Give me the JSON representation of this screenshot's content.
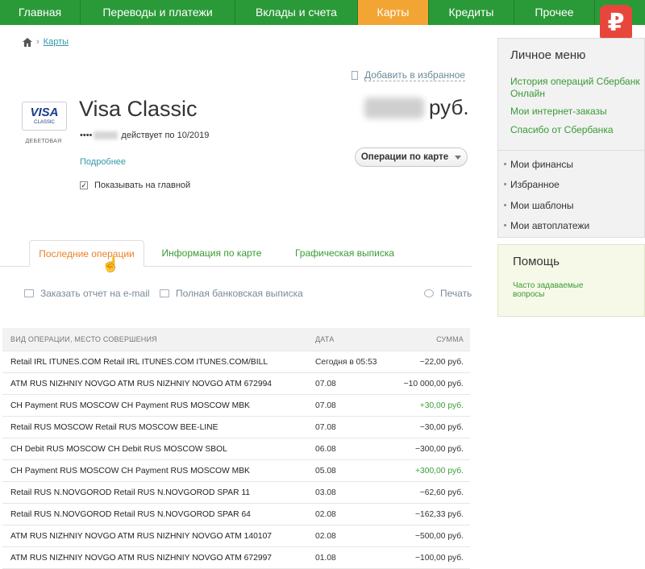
{
  "nav": [
    "Главная",
    "Переводы и платежи",
    "Вклады и счета",
    "Карты",
    "Кредиты",
    "Прочее"
  ],
  "nav_active": "Карты",
  "logo": "₽",
  "breadcrumb": {
    "current": "Карты"
  },
  "favorite": "Добавить в избранное",
  "card": {
    "brand": "VISA",
    "brand_sub": "CLASSIC",
    "type": "ДЕБЕТОВАЯ",
    "title": "Visa Classic",
    "number_prefix": "••••",
    "valid": "действует по 10/2019",
    "details": "Подробнее",
    "show_on_main": "Показывать на главной",
    "currency": "руб."
  },
  "ops_button": "Операции по карте",
  "tabs": [
    "Последние операции",
    "Информация по карте",
    "Графическая выписка"
  ],
  "actions": [
    "Заказать отчет на e-mail",
    "Полная банковская выписка",
    "Печать"
  ],
  "table": {
    "headers": [
      "ВИД ОПЕРАЦИИ, МЕСТО СОВЕРШЕНИЯ",
      "ДАТА",
      "СУММА"
    ],
    "rows": [
      {
        "desc": "Retail IRL ITUNES.COM Retail IRL ITUNES.COM ITUNES.COM/BILL",
        "date": "Сегодня в 05:53",
        "sum": "−22,00 руб.",
        "pos": false
      },
      {
        "desc": "ATM RUS NIZHNIY NOVGO ATM RUS NIZHNIY NOVGO ATM 672994",
        "date": "07.08",
        "sum": "−10 000,00 руб.",
        "pos": false
      },
      {
        "desc": "CH Payment RUS MOSCOW CH Payment RUS MOSCOW MBK",
        "date": "07.08",
        "sum": "+30,00 руб.",
        "pos": true
      },
      {
        "desc": "Retail RUS MOSCOW Retail RUS MOSCOW BEE-LINE",
        "date": "07.08",
        "sum": "−30,00 руб.",
        "pos": false
      },
      {
        "desc": "CH Debit RUS MOSCOW CH Debit RUS MOSCOW SBOL",
        "date": "06.08",
        "sum": "−300,00 руб.",
        "pos": false
      },
      {
        "desc": "CH Payment RUS MOSCOW CH Payment RUS MOSCOW MBK",
        "date": "05.08",
        "sum": "+300,00 руб.",
        "pos": true
      },
      {
        "desc": "Retail RUS N.NOVGOROD Retail RUS N.NOVGOROD SPAR 11",
        "date": "03.08",
        "sum": "−62,60 руб.",
        "pos": false
      },
      {
        "desc": "Retail RUS N.NOVGOROD Retail RUS N.NOVGOROD SPAR 64",
        "date": "02.08",
        "sum": "−162,33 руб.",
        "pos": false
      },
      {
        "desc": "ATM RUS NIZHNIY NOVGO ATM RUS NIZHNIY NOVGO ATM 140107",
        "date": "02.08",
        "sum": "−500,00 руб.",
        "pos": false
      },
      {
        "desc": "ATM RUS NIZHNIY NOVGO ATM RUS NIZHNIY NOVGO ATM 672997",
        "date": "01.08",
        "sum": "−100,00 руб.",
        "pos": false
      }
    ]
  },
  "sidebar": {
    "title": "Личное меню",
    "links": [
      "История операций Сбербанк Онлайн",
      "Мои интернет-заказы",
      "Спасибо от Сбербанка"
    ],
    "items": [
      "Мои финансы",
      "Избранное",
      "Мои шаблоны",
      "Мои автоплатежи"
    ]
  },
  "help": {
    "title": "Помощь",
    "link": "Часто задаваемые вопросы"
  },
  "colors": {
    "nav_green": "#2a9a38",
    "nav_active": "#f3a533",
    "link_green": "#3a9a35",
    "tab_active": "#e8822a",
    "positive": "#3aa03a"
  }
}
